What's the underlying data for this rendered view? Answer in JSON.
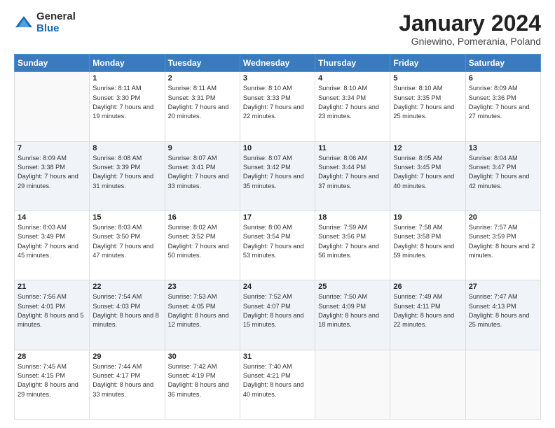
{
  "logo": {
    "general": "General",
    "blue": "Blue"
  },
  "title": {
    "month": "January 2024",
    "location": "Gniewino, Pomerania, Poland"
  },
  "headers": [
    "Sunday",
    "Monday",
    "Tuesday",
    "Wednesday",
    "Thursday",
    "Friday",
    "Saturday"
  ],
  "weeks": [
    [
      {
        "day": "",
        "sunrise": "",
        "sunset": "",
        "daylight": ""
      },
      {
        "day": "1",
        "sunrise": "Sunrise: 8:11 AM",
        "sunset": "Sunset: 3:30 PM",
        "daylight": "Daylight: 7 hours and 19 minutes."
      },
      {
        "day": "2",
        "sunrise": "Sunrise: 8:11 AM",
        "sunset": "Sunset: 3:31 PM",
        "daylight": "Daylight: 7 hours and 20 minutes."
      },
      {
        "day": "3",
        "sunrise": "Sunrise: 8:10 AM",
        "sunset": "Sunset: 3:33 PM",
        "daylight": "Daylight: 7 hours and 22 minutes."
      },
      {
        "day": "4",
        "sunrise": "Sunrise: 8:10 AM",
        "sunset": "Sunset: 3:34 PM",
        "daylight": "Daylight: 7 hours and 23 minutes."
      },
      {
        "day": "5",
        "sunrise": "Sunrise: 8:10 AM",
        "sunset": "Sunset: 3:35 PM",
        "daylight": "Daylight: 7 hours and 25 minutes."
      },
      {
        "day": "6",
        "sunrise": "Sunrise: 8:09 AM",
        "sunset": "Sunset: 3:36 PM",
        "daylight": "Daylight: 7 hours and 27 minutes."
      }
    ],
    [
      {
        "day": "7",
        "sunrise": "Sunrise: 8:09 AM",
        "sunset": "Sunset: 3:38 PM",
        "daylight": "Daylight: 7 hours and 29 minutes."
      },
      {
        "day": "8",
        "sunrise": "Sunrise: 8:08 AM",
        "sunset": "Sunset: 3:39 PM",
        "daylight": "Daylight: 7 hours and 31 minutes."
      },
      {
        "day": "9",
        "sunrise": "Sunrise: 8:07 AM",
        "sunset": "Sunset: 3:41 PM",
        "daylight": "Daylight: 7 hours and 33 minutes."
      },
      {
        "day": "10",
        "sunrise": "Sunrise: 8:07 AM",
        "sunset": "Sunset: 3:42 PM",
        "daylight": "Daylight: 7 hours and 35 minutes."
      },
      {
        "day": "11",
        "sunrise": "Sunrise: 8:06 AM",
        "sunset": "Sunset: 3:44 PM",
        "daylight": "Daylight: 7 hours and 37 minutes."
      },
      {
        "day": "12",
        "sunrise": "Sunrise: 8:05 AM",
        "sunset": "Sunset: 3:45 PM",
        "daylight": "Daylight: 7 hours and 40 minutes."
      },
      {
        "day": "13",
        "sunrise": "Sunrise: 8:04 AM",
        "sunset": "Sunset: 3:47 PM",
        "daylight": "Daylight: 7 hours and 42 minutes."
      }
    ],
    [
      {
        "day": "14",
        "sunrise": "Sunrise: 8:03 AM",
        "sunset": "Sunset: 3:49 PM",
        "daylight": "Daylight: 7 hours and 45 minutes."
      },
      {
        "day": "15",
        "sunrise": "Sunrise: 8:03 AM",
        "sunset": "Sunset: 3:50 PM",
        "daylight": "Daylight: 7 hours and 47 minutes."
      },
      {
        "day": "16",
        "sunrise": "Sunrise: 8:02 AM",
        "sunset": "Sunset: 3:52 PM",
        "daylight": "Daylight: 7 hours and 50 minutes."
      },
      {
        "day": "17",
        "sunrise": "Sunrise: 8:00 AM",
        "sunset": "Sunset: 3:54 PM",
        "daylight": "Daylight: 7 hours and 53 minutes."
      },
      {
        "day": "18",
        "sunrise": "Sunrise: 7:59 AM",
        "sunset": "Sunset: 3:56 PM",
        "daylight": "Daylight: 7 hours and 56 minutes."
      },
      {
        "day": "19",
        "sunrise": "Sunrise: 7:58 AM",
        "sunset": "Sunset: 3:58 PM",
        "daylight": "Daylight: 8 hours and 59 minutes."
      },
      {
        "day": "20",
        "sunrise": "Sunrise: 7:57 AM",
        "sunset": "Sunset: 3:59 PM",
        "daylight": "Daylight: 8 hours and 2 minutes."
      }
    ],
    [
      {
        "day": "21",
        "sunrise": "Sunrise: 7:56 AM",
        "sunset": "Sunset: 4:01 PM",
        "daylight": "Daylight: 8 hours and 5 minutes."
      },
      {
        "day": "22",
        "sunrise": "Sunrise: 7:54 AM",
        "sunset": "Sunset: 4:03 PM",
        "daylight": "Daylight: 8 hours and 8 minutes."
      },
      {
        "day": "23",
        "sunrise": "Sunrise: 7:53 AM",
        "sunset": "Sunset: 4:05 PM",
        "daylight": "Daylight: 8 hours and 12 minutes."
      },
      {
        "day": "24",
        "sunrise": "Sunrise: 7:52 AM",
        "sunset": "Sunset: 4:07 PM",
        "daylight": "Daylight: 8 hours and 15 minutes."
      },
      {
        "day": "25",
        "sunrise": "Sunrise: 7:50 AM",
        "sunset": "Sunset: 4:09 PM",
        "daylight": "Daylight: 8 hours and 18 minutes."
      },
      {
        "day": "26",
        "sunrise": "Sunrise: 7:49 AM",
        "sunset": "Sunset: 4:11 PM",
        "daylight": "Daylight: 8 hours and 22 minutes."
      },
      {
        "day": "27",
        "sunrise": "Sunrise: 7:47 AM",
        "sunset": "Sunset: 4:13 PM",
        "daylight": "Daylight: 8 hours and 25 minutes."
      }
    ],
    [
      {
        "day": "28",
        "sunrise": "Sunrise: 7:45 AM",
        "sunset": "Sunset: 4:15 PM",
        "daylight": "Daylight: 8 hours and 29 minutes."
      },
      {
        "day": "29",
        "sunrise": "Sunrise: 7:44 AM",
        "sunset": "Sunset: 4:17 PM",
        "daylight": "Daylight: 8 hours and 33 minutes."
      },
      {
        "day": "30",
        "sunrise": "Sunrise: 7:42 AM",
        "sunset": "Sunset: 4:19 PM",
        "daylight": "Daylight: 8 hours and 36 minutes."
      },
      {
        "day": "31",
        "sunrise": "Sunrise: 7:40 AM",
        "sunset": "Sunset: 4:21 PM",
        "daylight": "Daylight: 8 hours and 40 minutes."
      },
      {
        "day": "",
        "sunrise": "",
        "sunset": "",
        "daylight": ""
      },
      {
        "day": "",
        "sunrise": "",
        "sunset": "",
        "daylight": ""
      },
      {
        "day": "",
        "sunrise": "",
        "sunset": "",
        "daylight": ""
      }
    ]
  ]
}
